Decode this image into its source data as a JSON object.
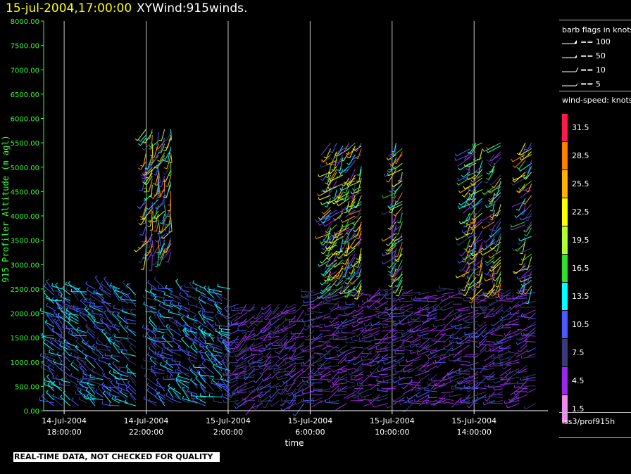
{
  "header": {
    "datetime": "15-jul-2004,17:00:00",
    "title": "XYWind:915winds."
  },
  "footer": {
    "note": "REAL-TIME DATA, NOT CHECKED FOR QUALITY"
  },
  "legend": {
    "barb_title": "barb flags in knots",
    "barbs": [
      {
        "label": "== 100"
      },
      {
        "label": "== 50"
      },
      {
        "label": "== 10"
      },
      {
        "label": "== 5"
      }
    ],
    "speed_title": "wind-speed: knots",
    "site": "iss3/prof915h"
  },
  "colors": {
    "background": "#000000",
    "axis": "#33ff33",
    "time_axis": "#ffffff",
    "header_time": "#ffff00"
  },
  "chart_data": {
    "type": "wind_barb_time_height",
    "title": "XYWind:915winds.",
    "xlabel": "time",
    "ylabel": "915 Profiler Altitude (m agl)",
    "y_range": [
      0,
      8000
    ],
    "y_ticks": [
      "0.00",
      "500.00",
      "1000.00",
      "1500.00",
      "2000.00",
      "2500.00",
      "3000.00",
      "3500.00",
      "4000.00",
      "4500.00",
      "5000.00",
      "5500.00",
      "6000.00",
      "6500.00",
      "7000.00",
      "7500.00",
      "8000.00"
    ],
    "x_ticks": [
      {
        "date": "14-Jul-2004",
        "time": "18:00:00",
        "hour": 0
      },
      {
        "date": "14-Jul-2004",
        "time": "22:00:00",
        "hour": 4
      },
      {
        "date": "15-Jul-2004",
        "time": "2:00:00",
        "hour": 8
      },
      {
        "date": "15-Jul-2004",
        "time": "6:00:00",
        "hour": 12
      },
      {
        "date": "15-Jul-2004",
        "time": "10:00:00",
        "hour": 16
      },
      {
        "date": "15-Jul-2004",
        "time": "14:00:00",
        "hour": 20
      }
    ],
    "x_range_hours": [
      -1.0,
      23.6
    ],
    "vertical_gridlines": true,
    "colorbar": {
      "unit": "knots",
      "labels": [
        "31.5",
        "28.5",
        "25.5",
        "22.5",
        "19.5",
        "16.5",
        "13.5",
        "10.5",
        "7.5",
        "4.5",
        "1.5"
      ],
      "colors": [
        "#ff1a4a",
        "#ff8000",
        "#ffb000",
        "#ffff00",
        "#b0ff30",
        "#30e030",
        "#00ffff",
        "#4a5aff",
        "#3a3a7a",
        "#9a28e8",
        "#ee88ee"
      ]
    },
    "series": [
      {
        "hours": [
          -0.5,
          -0.1,
          0.3,
          0.7,
          1.1,
          1.5,
          1.9,
          2.3,
          2.7,
          3.1,
          3.5,
          4.5,
          4.9,
          5.3,
          5.7,
          6.1,
          6.5,
          6.9,
          7.3,
          7.7,
          8.1
        ],
        "altitude_range": [
          100,
          2500
        ],
        "speed_range": [
          7,
          14
        ],
        "direction_deg": 300
      },
      {
        "hours": [
          8.5,
          8.9,
          9.3,
          9.7,
          10.1,
          10.5,
          10.9,
          11.3,
          11.7
        ],
        "altitude_range": [
          150,
          2200
        ],
        "speed_range": [
          4,
          10
        ],
        "direction_deg": 240
      },
      {
        "hours": [
          12.2,
          12.6,
          13.0,
          13.4,
          13.8,
          14.2,
          14.6,
          15.0,
          15.4,
          15.8,
          16.2,
          16.6,
          17.0,
          17.4,
          17.8,
          18.2,
          18.6,
          19.0,
          19.4,
          19.8,
          20.2,
          20.6,
          21.0,
          21.4,
          21.8,
          22.2,
          22.6,
          23.0
        ],
        "altitude_range": [
          150,
          2500
        ],
        "speed_range": [
          3,
          10
        ],
        "direction_deg": 250
      },
      {
        "hours": [
          4.0,
          4.3,
          4.6,
          4.9,
          5.2
        ],
        "altitude_range": [
          3200,
          5800
        ],
        "speed_range": [
          4,
          30
        ],
        "direction_deg": 200
      },
      {
        "hours": [
          13.0,
          13.3,
          13.6,
          13.9,
          14.2,
          14.5,
          16.2,
          16.5,
          19.8,
          20.1,
          20.4,
          21.0,
          21.3,
          22.5,
          22.8
        ],
        "altitude_range": [
          2500,
          5500
        ],
        "speed_range": [
          3,
          28
        ],
        "direction_deg": 220
      }
    ]
  }
}
